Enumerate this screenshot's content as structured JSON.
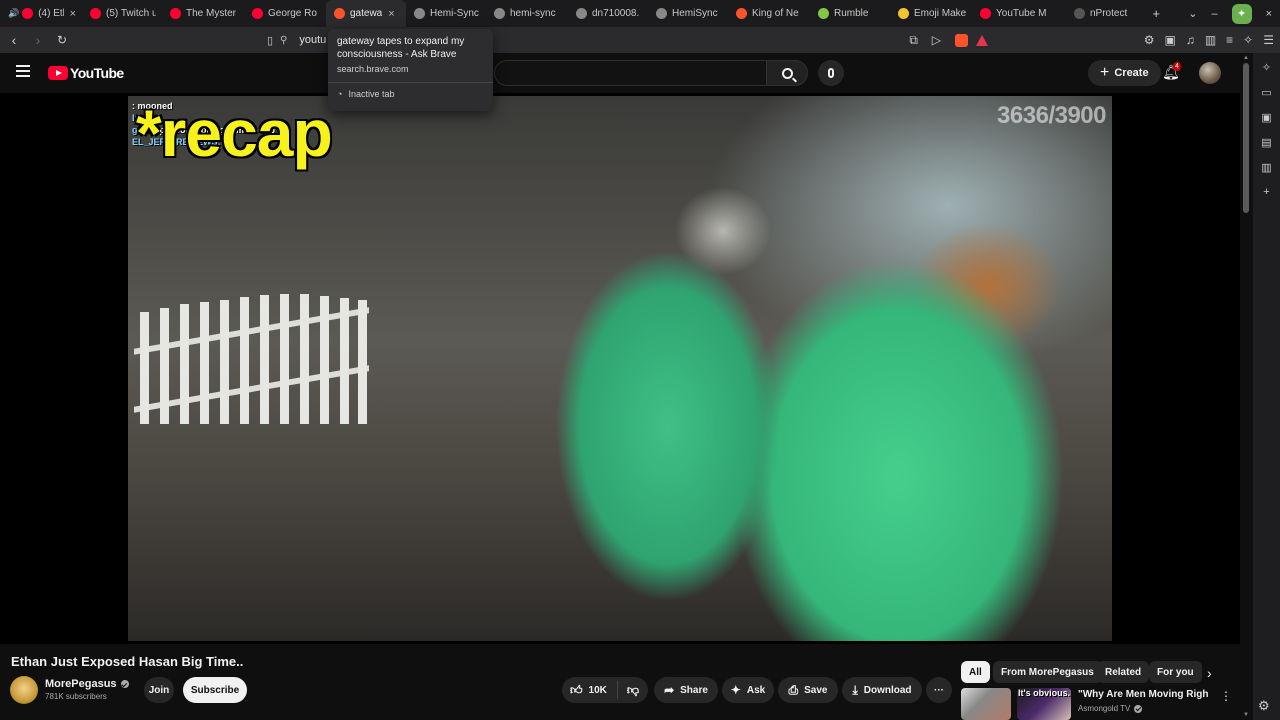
{
  "tabs": [
    {
      "title": "(4) Eth",
      "color": "#ff0033",
      "close": "×",
      "audio": "🔊"
    },
    {
      "title": "(5) Twitch u",
      "color": "#ff0033"
    },
    {
      "title": "The Myster",
      "color": "#ff0033"
    },
    {
      "title": "George Ro",
      "color": "#ff0033"
    },
    {
      "title": "gatewa",
      "color": "#fb542b",
      "active": true,
      "close": "×"
    },
    {
      "title": "Hemi-Sync",
      "color": "#888888"
    },
    {
      "title": "hemi-sync",
      "color": "#888888"
    },
    {
      "title": "dn710008.",
      "color": "#888888"
    },
    {
      "title": "HemiSync",
      "color": "#888888"
    },
    {
      "title": "King of Ne",
      "color": "#fb542b"
    },
    {
      "title": "Rumble",
      "color": "#85c742"
    },
    {
      "title": "Emoji Make",
      "color": "#f4c430"
    },
    {
      "title": "YouTube M",
      "color": "#ff0033"
    },
    {
      "title": "nProtect Ga",
      "color": "#555555"
    }
  ],
  "new_tab_label": "+",
  "tab_menu_icon": "⌄",
  "window_controls": {
    "minimize": "–",
    "close": "×"
  },
  "address": {
    "text": "youtu"
  },
  "tooltip": {
    "title": "gateway tapes to expand my consciousness - Ask Brave",
    "url": "search.brave.com",
    "status": "Inactive tab"
  },
  "youtube": {
    "logo_text": "YouTube",
    "create_label": "Create",
    "notification_count": "4",
    "brand_color": "#ff0033"
  },
  "video": {
    "overlay_text": "*recap",
    "counter": "3636/3900",
    "chat": [
      {
        "user": "",
        "msg": ": mooned"
      },
      {
        "user": "Incred",
        "msg": ""
      },
      {
        "user": "gridlo",
        "msg": " pls some one gift me 5 sub"
      },
      {
        "user": "EL_JEFE_REVIEWS:",
        "msg": ""
      }
    ]
  },
  "info": {
    "title": "Ethan Just Exposed Hasan Big Time..",
    "channel": "MorePegasus",
    "subscribers": "781K subscribers",
    "join_label": "Join",
    "subscribe_label": "Subscribe",
    "likes": "10K",
    "share_label": "Share",
    "ask_label": "Ask",
    "save_label": "Save",
    "download_label": "Download",
    "more_label": "···"
  },
  "chips": [
    "All",
    "From MorePegasus",
    "Related",
    "For you"
  ],
  "related": {
    "thumb_text": "It's obvious.",
    "title": "\"Why Are Men Moving Right?\"",
    "channel": "Asmongold TV"
  }
}
